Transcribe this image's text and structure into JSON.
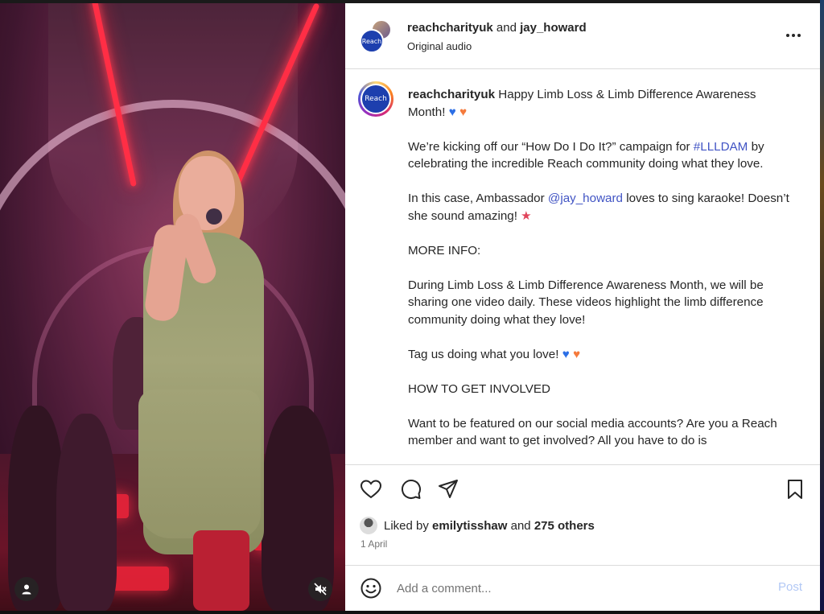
{
  "header": {
    "account": "reachcharityuk",
    "joiner": "and",
    "collaborator": "jay_howard",
    "audio": "Original audio"
  },
  "caption": {
    "username": "reachcharityuk",
    "line1_text": "Happy Limb Loss & Limb Difference Awareness Month!",
    "p2_before": "We’re kicking off our “How Do I Do It?” campaign for ",
    "p2_hashtag": "#LLLDAM",
    "p2_after": " by celebrating the incredible Reach community doing what they love.",
    "p3_before": "In this case, Ambassador ",
    "p3_mention": "@jay_howard",
    "p3_after": " loves to sing karaoke! Doesn’t she sound amazing!",
    "p4": "MORE INFO:",
    "p5": "During Limb Loss & Limb Difference Awareness Month, we will be sharing one video daily. These videos highlight the limb difference community doing what they love!",
    "p6": "Tag us doing what you love!",
    "p7": "HOW TO GET INVOLVED",
    "p8": "Want to be featured on our social media accounts? Are you a Reach member and want to get involved? All you have to do is"
  },
  "likes": {
    "prefix": "Liked by",
    "user": "emilytisshaw",
    "joiner": "and",
    "others": "275 others"
  },
  "date": "1 April",
  "comment": {
    "placeholder": "Add a comment...",
    "post_label": "Post"
  },
  "logo_text": "Reach",
  "colors": {
    "link": "#4154c4",
    "post_disabled": "#b2c8f5",
    "brand": "#1d3fae"
  }
}
